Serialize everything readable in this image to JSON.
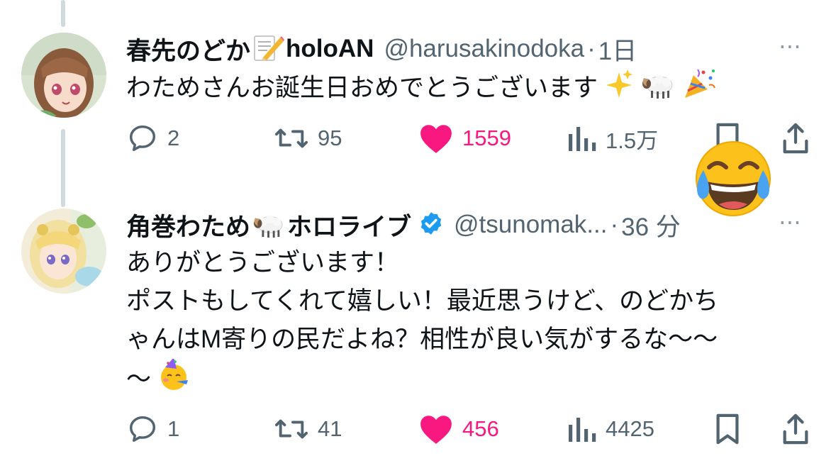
{
  "tweet1": {
    "name": "春先のどか",
    "name_suffix": "holoAN",
    "handle": "@harusakinodoka",
    "sep": "·",
    "time": "1日",
    "text": "わためさんお誕生日おめでとうございます",
    "text_emojis": [
      "sparkles-emoji",
      "ram-emoji",
      "party-popper-emoji"
    ],
    "name_emoji": "memo-emoji",
    "stats": {
      "replies": "2",
      "reposts": "95",
      "likes": "1559",
      "views": "1.5万"
    }
  },
  "tweet2": {
    "name": "角巻わため",
    "name_suffix": "ホロライブ",
    "verified": true,
    "handle": "@tsunomak...",
    "sep": "·",
    "time": "36 分",
    "name_emoji": "ram-emoji",
    "lines": [
      "ありがとうございます！",
      "ポストもしてくれて嬉しい！最近思うけど、のどかち",
      "ゃんはM寄りの民だよね？相性が良い気がするな〜〜",
      "〜"
    ],
    "trailing_emoji": "partying-face-emoji",
    "stats": {
      "replies": "1",
      "reposts": "41",
      "likes": "456",
      "views": "4425"
    }
  },
  "more_icon": "⋯",
  "overlay_emoji": "tears-of-joy-emoji",
  "colors": {
    "like": "#f91880",
    "muted": "#536471",
    "verified": "#1d9bf0",
    "thread": "#cfd9de"
  }
}
